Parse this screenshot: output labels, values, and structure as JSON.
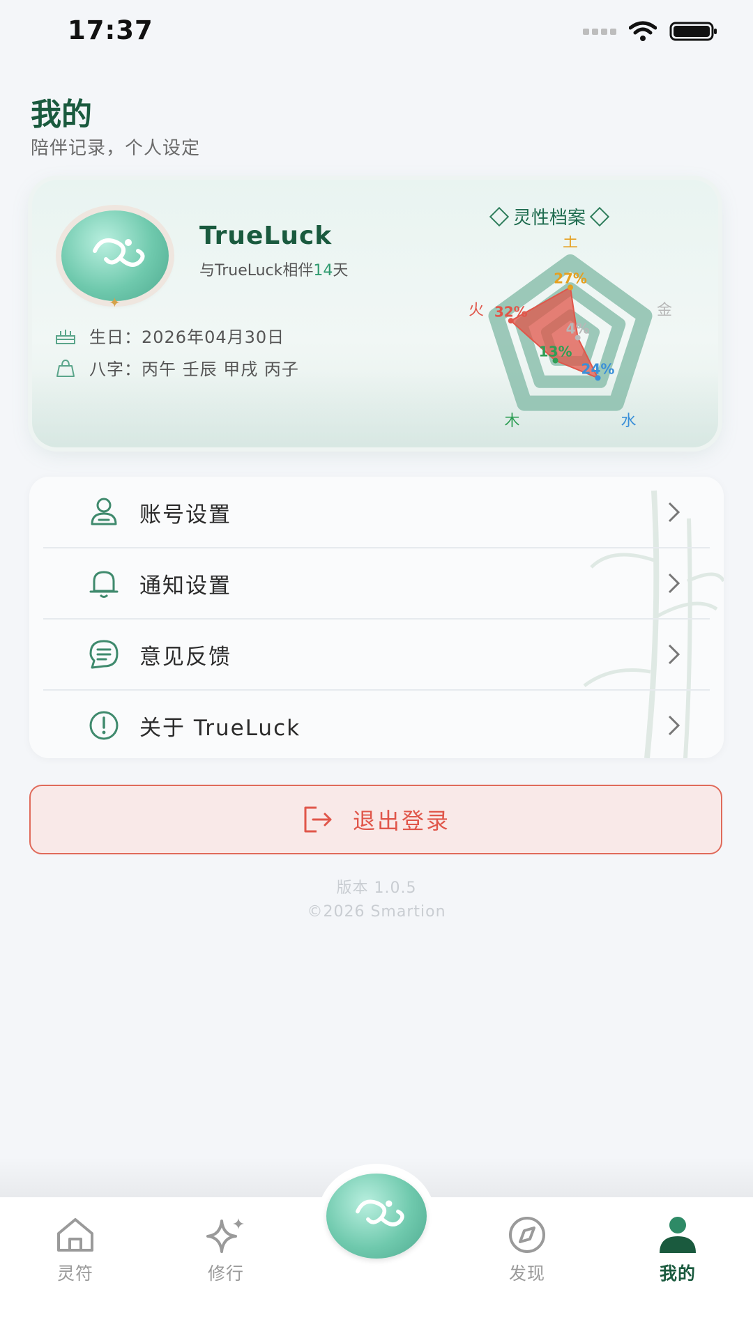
{
  "status_bar": {
    "time": "17:37"
  },
  "header": {
    "title": "我的",
    "subtitle": "陪伴记录，个人设定"
  },
  "profile": {
    "name": "TrueLuck",
    "companion_prefix": "与TrueLuck相伴",
    "companion_days": "14",
    "companion_suffix": "天",
    "birthday_label": "生日：",
    "birthday_value": "2026年04月30日",
    "bazi_label": "八字：",
    "bazi_value": "丙午 壬辰 甲戌 丙子",
    "badge": "灵性档案"
  },
  "chart_data": {
    "type": "radar",
    "axes": [
      "土",
      "金",
      "水",
      "木",
      "火"
    ],
    "values": [
      27,
      4,
      24,
      13,
      32
    ],
    "value_labels": [
      "27%",
      "4%",
      "24%",
      "13%",
      "32%"
    ],
    "axis_colors": [
      "#e6a020",
      "#b8b8b8",
      "#3a8fd8",
      "#2e9e55",
      "#e0564a"
    ],
    "max": 40
  },
  "menu": {
    "items": [
      {
        "label": "账号设置",
        "icon": "user-icon"
      },
      {
        "label": "通知设置",
        "icon": "bell-icon"
      },
      {
        "label": "意见反馈",
        "icon": "chat-icon"
      },
      {
        "label": "关于 TrueLuck",
        "icon": "info-icon"
      }
    ]
  },
  "logout": {
    "label": "退出登录"
  },
  "footer": {
    "version": "版本 1.0.5",
    "copyright": "©2026 Smartion"
  },
  "tabbar": {
    "tabs": [
      {
        "label": "灵符",
        "icon": "home-icon"
      },
      {
        "label": "修行",
        "icon": "sparkle-icon"
      },
      {
        "label": "发现",
        "icon": "compass-icon"
      },
      {
        "label": "我的",
        "icon": "person-icon"
      }
    ],
    "active": "我的"
  },
  "colors": {
    "accent": "#1a5a3e",
    "logout": "#e0564a"
  }
}
